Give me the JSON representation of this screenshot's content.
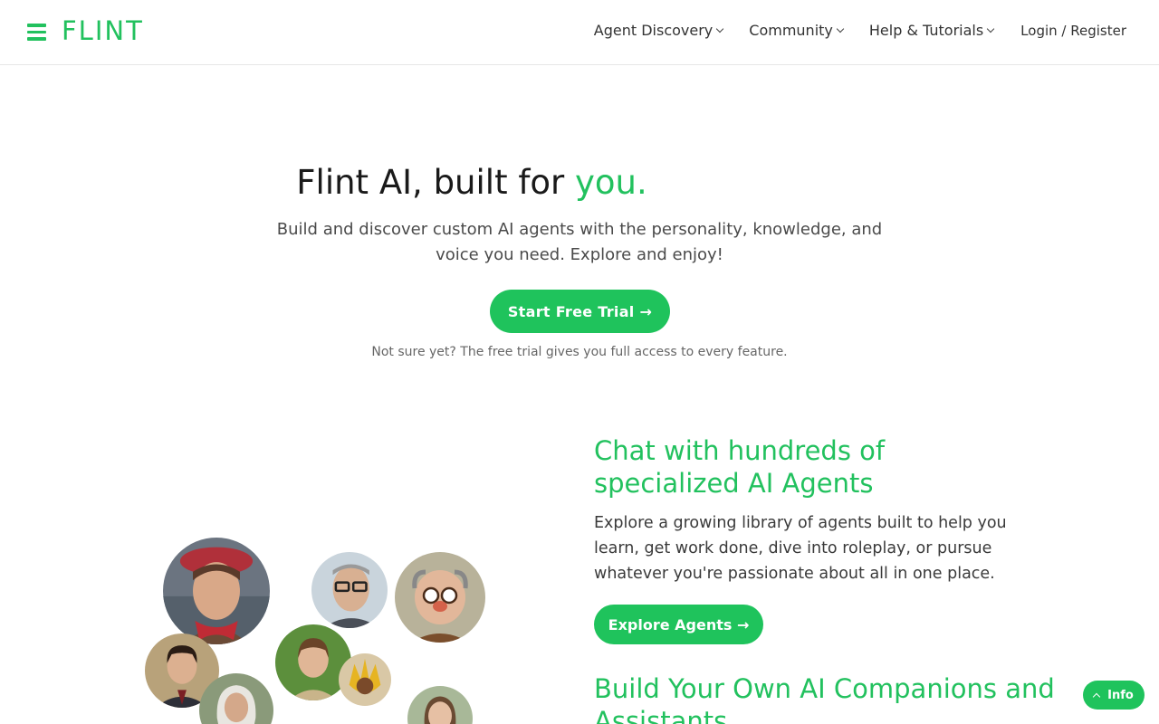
{
  "header": {
    "logo": "FLINT",
    "nav": [
      {
        "label": "Agent Discovery"
      },
      {
        "label": "Community"
      },
      {
        "label": "Help & Tutorials"
      }
    ],
    "login": "Login / Register"
  },
  "hero": {
    "title_main": "Flint AI, built for ",
    "title_accent": "you.",
    "subtitle": "Build and discover custom AI agents with the personality, knowledge, and voice you need. Explore and enjoy!",
    "cta": "Start Free Trial →",
    "note": "Not sure yet? The free trial gives you full access to every feature."
  },
  "feature": {
    "title": "Chat with hundreds of specialized AI Agents",
    "text": "Explore a growing library of agents built to help you learn, get work done, dive into roleplay, or pursue whatever you're passionate about all in one place.",
    "button": "Explore Agents →",
    "next_title": "Build Your Own AI Companions and Assistants"
  },
  "info_button": "Info",
  "colors": {
    "accent": "#22c15e",
    "button": "#1fc35c"
  }
}
